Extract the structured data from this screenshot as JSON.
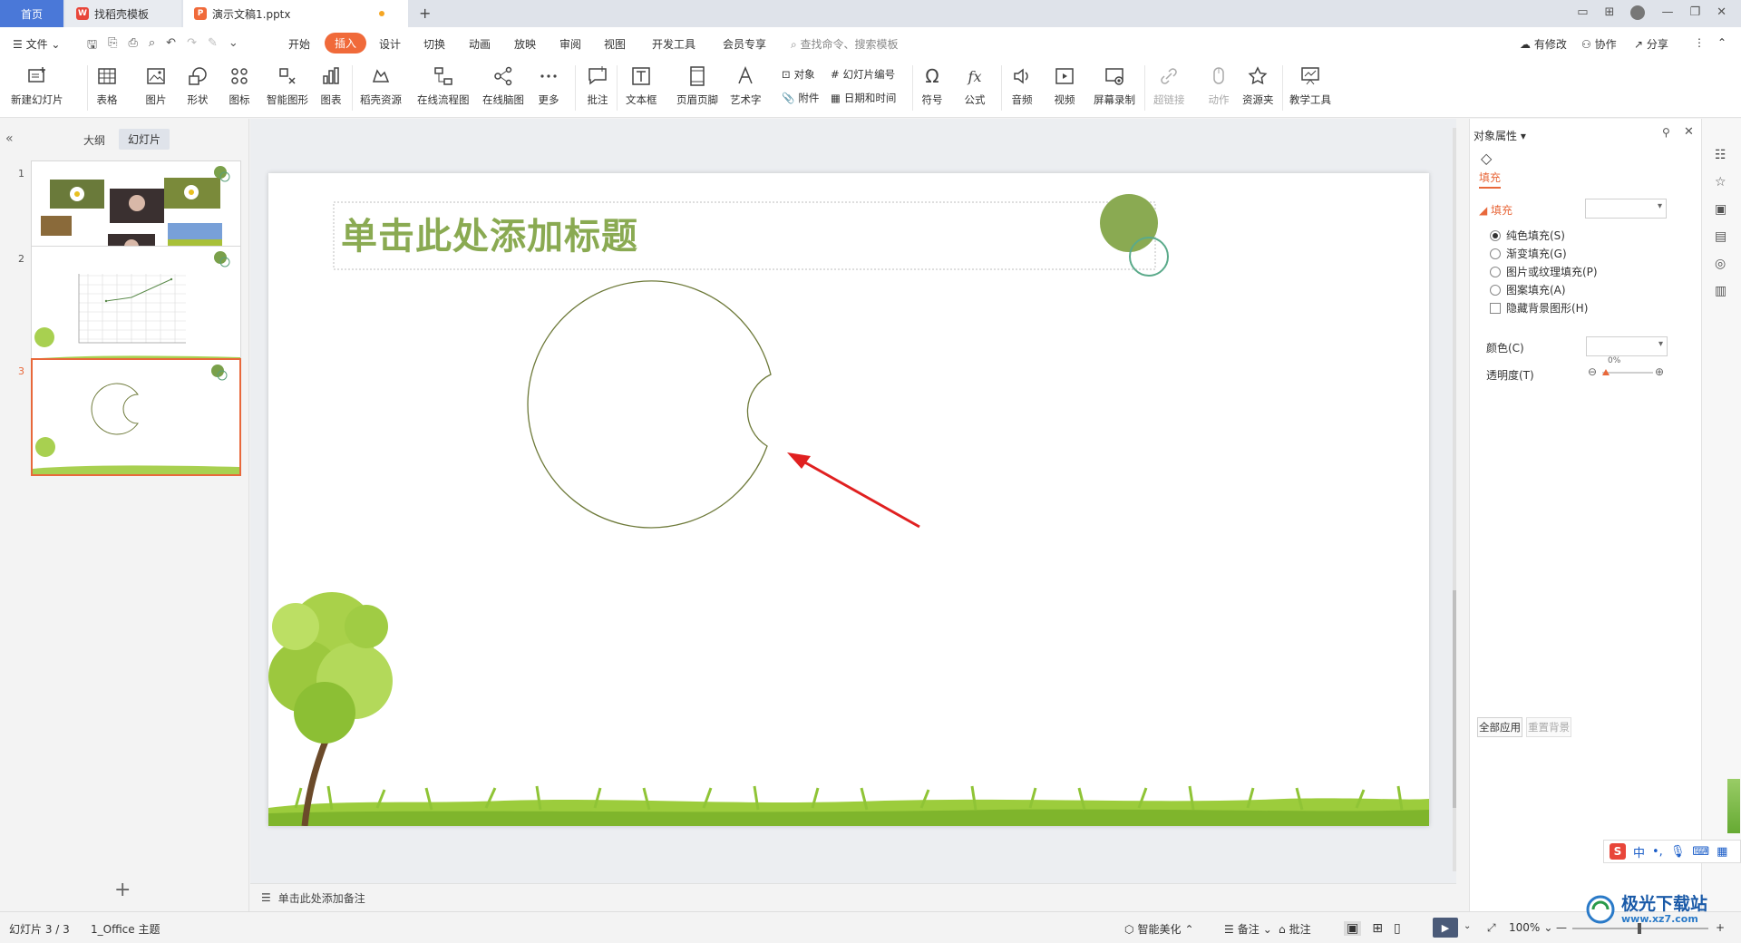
{
  "tabs": {
    "home": "首页",
    "store": "找稻壳模板",
    "doc": "演示文稿1.pptx",
    "new_tab": "+"
  },
  "menu": {
    "file": "文件",
    "items": [
      "开始",
      "插入",
      "设计",
      "切换",
      "动画",
      "放映",
      "审阅",
      "视图",
      "开发工具",
      "会员专享"
    ],
    "active": "插入",
    "search_placeholder": "查找命令、搜索模板",
    "right": [
      "有修改",
      "协作",
      "分享"
    ]
  },
  "ribbon": {
    "new_slide": "新建幻灯片",
    "table": "表格",
    "picture": "图片",
    "shape": "形状",
    "icon": "图标",
    "smart_art": "智能图形",
    "chart": "图表",
    "docer_res": "稻壳资源",
    "online_flow": "在线流程图",
    "online_mind": "在线脑图",
    "more": "更多",
    "comment": "批注",
    "textbox": "文本框",
    "header_footer": "页眉页脚",
    "wordart": "艺术字",
    "object": "对象",
    "slide_number": "幻灯片编号",
    "attachment": "附件",
    "date_time": "日期和时间",
    "symbol": "符号",
    "formula": "公式",
    "audio": "音频",
    "video": "视频",
    "screen_record": "屏幕录制",
    "hyperlink": "超链接",
    "action": "动作",
    "resource": "资源夹",
    "teaching": "教学工具"
  },
  "left_panel": {
    "tab_outline": "大纲",
    "tab_slides": "幻灯片",
    "slide_numbers": [
      "1",
      "2",
      "3"
    ],
    "add": "+"
  },
  "slide": {
    "title_placeholder": "单击此处添加标题"
  },
  "notes_placeholder": "单击此处添加备注",
  "right_panel": {
    "header": "对象属性",
    "tab_fill": "填充",
    "section_fill": "填充",
    "options": [
      "纯色填充(S)",
      "渐变填充(G)",
      "图片或纹理填充(P)",
      "图案填充(A)"
    ],
    "selected_option": "纯色填充(S)",
    "hide_bg": "隐藏背景图形(H)",
    "color_label": "颜色(C)",
    "transparency_label": "透明度(T)",
    "transparency_value": "0%",
    "apply_all": "全部应用",
    "reset_bg": "重置背景"
  },
  "status": {
    "slide_info": "幻灯片 3 / 3",
    "theme": "1_Office 主题",
    "beautify": "智能美化",
    "notes": "备注",
    "comment": "批注",
    "zoom": "100%"
  },
  "ime": {
    "lang": "中"
  },
  "watermark": {
    "text": "极光下载站",
    "url": "www.xz7.com"
  },
  "colors": {
    "accent_orange": "#f06a3a",
    "title_green": "#8aaa52",
    "circle_stroke": "#6e7a3a",
    "arrow_red": "#e02020"
  }
}
